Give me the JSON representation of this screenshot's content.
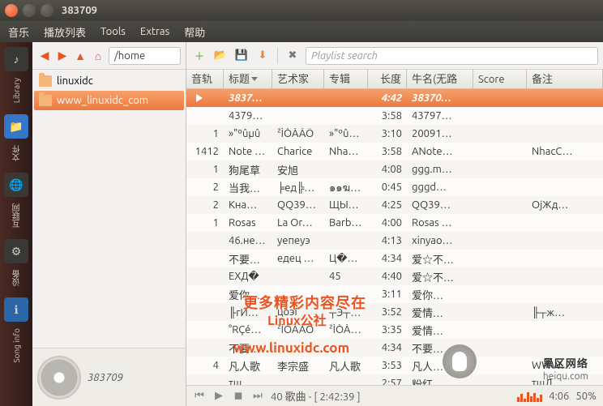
{
  "window": {
    "title": "383709"
  },
  "menu": [
    "音乐",
    "播放列表",
    "Tools",
    "Extras",
    "帮助"
  ],
  "launcher": [
    {
      "label": "Library"
    },
    {
      "label": "文件"
    },
    {
      "label": "互联网"
    },
    {
      "label": "设备"
    },
    {
      "label": "Song info"
    }
  ],
  "nav": {
    "path": "/home"
  },
  "tree": [
    {
      "name": "linuxidc",
      "selected": false
    },
    {
      "name": "www_linuxidc_com",
      "selected": true
    }
  ],
  "nowplaying": {
    "title": "383709"
  },
  "toolbar": {
    "search_placeholder": "Playlist search"
  },
  "columns": [
    "音轨",
    "标题",
    "艺术家",
    "专辑",
    "长度",
    "牛名(无路",
    "Score",
    "备注"
  ],
  "tracks": [
    {
      "playing": true,
      "tn": "",
      "title": "3837…",
      "artist": "",
      "album": "",
      "len": "4:42",
      "file": "38370…",
      "score": "",
      "note": ""
    },
    {
      "tn": "",
      "title": "4379…",
      "artist": "",
      "album": "",
      "len": "3:58",
      "file": "43797…",
      "score": "",
      "note": ""
    },
    {
      "tn": "1",
      "title": "»\"ºûµû",
      "artist": "²ÌÒÀÁÖ",
      "album": "»\"ºûµ…",
      "len": "3:10",
      "file": "20091…",
      "score": "",
      "note": ""
    },
    {
      "tn": "1412",
      "title": "Note …",
      "artist": "Charice",
      "album": "Nhac…",
      "len": "3:58",
      "file": "ANote…",
      "score": "",
      "note": "NhacC…"
    },
    {
      "tn": "1",
      "title": "狗尾草",
      "artist": "安旭",
      "album": "",
      "len": "4:08",
      "file": "ggg.m…",
      "score": "",
      "note": ""
    },
    {
      "tn": "2",
      "title": "当我…",
      "artist": "╞ед╠…",
      "album": "๑๑ฆ…",
      "len": "0:45",
      "file": "gggd…",
      "score": "",
      "note": ""
    },
    {
      "tn": "2",
      "title": "Кна…",
      "artist": "QQ39…",
      "album": "ЩЫ…",
      "len": "4:25",
      "file": "QQ39…",
      "score": "",
      "note": "ОјЖд…"
    },
    {
      "tn": "1",
      "title": "Rosas",
      "artist": "La Or…",
      "album": "Barbi…",
      "len": "4:00",
      "file": "Rosas …",
      "score": "",
      "note": ""
    },
    {
      "tn": "",
      "title": "46.не…",
      "artist": "уепеуэ",
      "album": "",
      "len": "4:13",
      "file": "xinyao…",
      "score": "",
      "note": ""
    },
    {
      "tn": "",
      "title": "不要…",
      "artist": "едец …",
      "album": "Ц�…",
      "len": "4:34",
      "file": "爱☆不…",
      "score": "",
      "note": ""
    },
    {
      "tn": "",
      "title": "EXД�",
      "artist": "",
      "album": "45",
      "len": "4:40",
      "file": "爱☆不…",
      "score": "",
      "note": ""
    },
    {
      "tn": "",
      "title": "爱你…",
      "artist": "",
      "album": "",
      "len": "3:11",
      "file": "爱你…",
      "score": "",
      "note": ""
    },
    {
      "tn": "",
      "title": "╟гИ…",
      "artist": "цоэГ",
      "album": "┬Э┬…",
      "len": "3:52",
      "file": "爱情…",
      "score": "",
      "note": "╟┬ж…"
    },
    {
      "tn": "",
      "title": "°RÇé…",
      "artist": "²ÌÒÀÁÖ",
      "album": "²ÌÒÀ…",
      "len": "3:35",
      "file": "爱情…",
      "score": "",
      "note": ""
    },
    {
      "tn": "",
      "title": "不要…",
      "artist": "",
      "album": "",
      "len": "4:34",
      "file": "不要…",
      "score": "",
      "note": ""
    },
    {
      "tn": "4",
      "title": "凡人歌",
      "artist": "李宗盛",
      "album": "凡人歌",
      "len": "3:53",
      "file": "凡人…",
      "score": "",
      "note": "WWW…"
    },
    {
      "tn": "",
      "title": "тш…",
      "artist": "",
      "album": "",
      "len": "2:57",
      "file": "粉红…",
      "score": "",
      "note": "тшЛ…"
    }
  ],
  "status": {
    "count": "40 歌曲 - [ 2:42:39 ]",
    "time": "4:06",
    "pct": "50%"
  },
  "watermarks": {
    "w1": "更多精彩内容尽在",
    "w2": "Linux公社",
    "w3": "www.linuxidc.com",
    "w4": "黑区网络",
    "w4b": "heiqu.com"
  }
}
